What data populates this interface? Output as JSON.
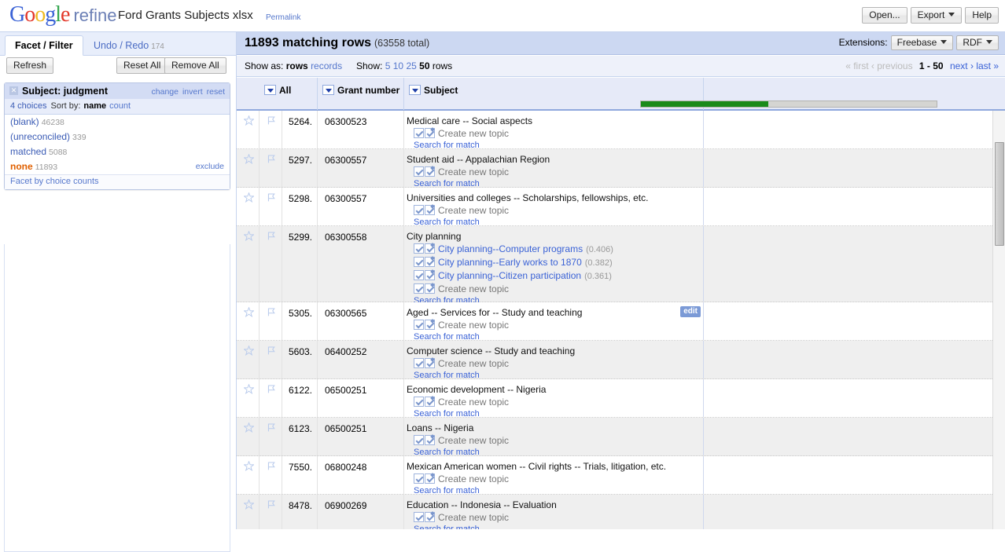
{
  "header": {
    "logo": {
      "google": "Google",
      "refine": "refine"
    },
    "project_name": "Ford Grants Subjects xlsx",
    "permalink": "Permalink",
    "buttons": [
      {
        "label": "Open...",
        "name": "open-button",
        "caret": false
      },
      {
        "label": "Export",
        "name": "export-button",
        "caret": true
      },
      {
        "label": "Help",
        "name": "help-button",
        "caret": false
      }
    ]
  },
  "sidebar": {
    "tabs": [
      {
        "label": "Facet / Filter",
        "active": true
      },
      {
        "label": "Undo / Redo",
        "count": "174",
        "active": false
      }
    ],
    "refresh_label": "Refresh",
    "reset_all_label": "Reset All",
    "remove_all_label": "Remove All",
    "facet": {
      "close": "✕",
      "title": "Subject: judgment",
      "actions": [
        "change",
        "invert",
        "reset"
      ],
      "choices_count": "4 choices",
      "sort_label": "Sort by:",
      "sort_options": [
        {
          "label": "name",
          "selected": true
        },
        {
          "label": "count",
          "selected": false
        }
      ],
      "choices": [
        {
          "name": "(blank)",
          "count": "46238",
          "selected": false,
          "exclude": ""
        },
        {
          "name": "(unreconciled)",
          "count": "339",
          "selected": false,
          "exclude": ""
        },
        {
          "name": "matched",
          "count": "5088",
          "selected": false,
          "exclude": ""
        },
        {
          "name": "none",
          "count": "11893",
          "selected": true,
          "exclude": "exclude"
        }
      ],
      "footer": "Facet by choice counts"
    }
  },
  "main": {
    "summary": {
      "matching": "11893 matching rows",
      "total": "(63558 total)"
    },
    "extensions": {
      "label": "Extensions:",
      "buttons": [
        {
          "label": "Freebase",
          "caret": true
        },
        {
          "label": "RDF",
          "caret": true
        }
      ]
    },
    "controls": {
      "show_as_label": "Show as:",
      "show_as_options": [
        {
          "label": "rows",
          "selected": true
        },
        {
          "label": "records",
          "selected": false
        }
      ],
      "show_label": "Show:",
      "show_options": [
        {
          "label": "5",
          "selected": false
        },
        {
          "label": "10",
          "selected": false
        },
        {
          "label": "25",
          "selected": false
        },
        {
          "label": "50",
          "selected": true
        }
      ],
      "show_suffix": "rows"
    },
    "pagination": {
      "first": "« first",
      "previous": "‹ previous",
      "current": "1 - 50",
      "next": "next ›",
      "last": "last »"
    },
    "columns": [
      {
        "title": "All",
        "name": "column-all"
      },
      {
        "title": "Grant number",
        "name": "column-grant-number"
      },
      {
        "title": "Subject",
        "name": "column-subject"
      }
    ],
    "progress": {
      "percent": 43,
      "color": "#1a8a1a"
    },
    "labels": {
      "create_new_topic": "Create new topic",
      "search_for_match": "Search for match",
      "edit": "edit"
    },
    "rows": [
      {
        "index": "5264.",
        "grant_number": "06300523",
        "subject": "Medical care -- Social aspects",
        "candidates": [],
        "edit": false
      },
      {
        "index": "5297.",
        "grant_number": "06300557",
        "subject": "Student aid -- Appalachian Region",
        "candidates": [],
        "edit": false
      },
      {
        "index": "5298.",
        "grant_number": "06300557",
        "subject": "Universities and colleges -- Scholarships, fellowships, etc.",
        "candidates": [],
        "edit": false
      },
      {
        "index": "5299.",
        "grant_number": "06300558",
        "subject": "City planning",
        "candidates": [
          {
            "label": "City planning--Computer programs",
            "score": "(0.406)"
          },
          {
            "label": "City planning--Early works to 1870",
            "score": "(0.382)"
          },
          {
            "label": "City planning--Citizen participation",
            "score": "(0.361)"
          }
        ],
        "edit": false
      },
      {
        "index": "5305.",
        "grant_number": "06300565",
        "subject": "Aged -- Services for -- Study and teaching",
        "candidates": [],
        "edit": true
      },
      {
        "index": "5603.",
        "grant_number": "06400252",
        "subject": "Computer science -- Study and teaching",
        "candidates": [],
        "edit": false
      },
      {
        "index": "6122.",
        "grant_number": "06500251",
        "subject": "Economic development -- Nigeria",
        "candidates": [],
        "edit": false
      },
      {
        "index": "6123.",
        "grant_number": "06500251",
        "subject": "Loans -- Nigeria",
        "candidates": [],
        "edit": false
      },
      {
        "index": "7550.",
        "grant_number": "06800248",
        "subject": "Mexican American women -- Civil rights -- Trials, litigation, etc.",
        "candidates": [],
        "edit": false
      },
      {
        "index": "8478.",
        "grant_number": "06900269",
        "subject": "Education -- Indonesia -- Evaluation",
        "candidates": [],
        "edit": false
      }
    ]
  }
}
